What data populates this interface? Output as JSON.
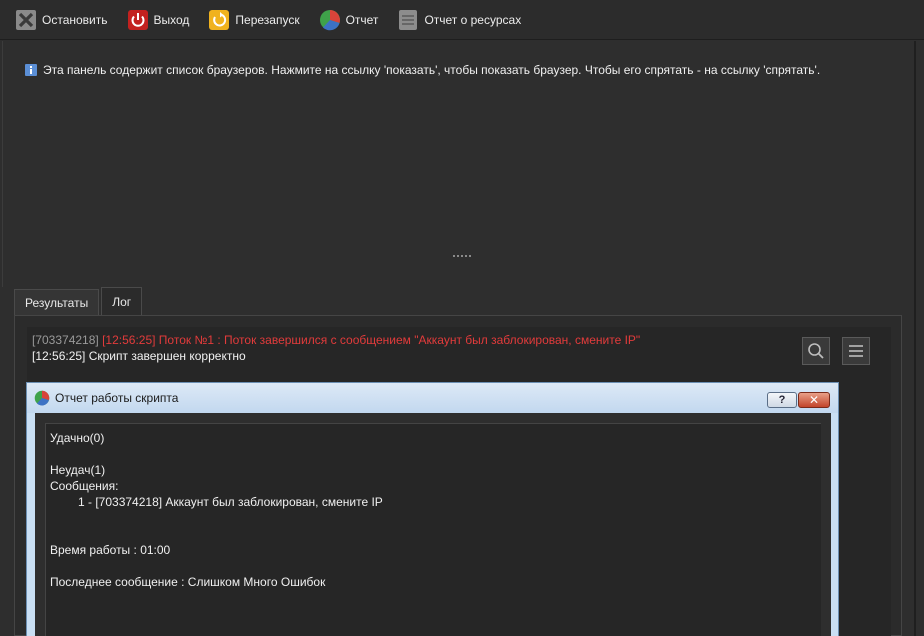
{
  "toolbar": {
    "stop_label": "Остановить",
    "exit_label": "Выход",
    "restart_label": "Перезапуск",
    "report_label": "Отчет",
    "resources_label": "Отчет о ресурсах"
  },
  "info": {
    "text": "Эта панель содержит список браузеров. Нажмите на ссылку 'показать', чтобы показать браузер. Чтобы его спрятать - на ссылку 'спрятать'."
  },
  "tabs": [
    {
      "label": "Результаты",
      "active": false
    },
    {
      "label": "Лог",
      "active": true
    }
  ],
  "log": {
    "line1_id": "[703374218]",
    "line1_message": "[12:56:25] Поток №1 : Поток завершился с сообщением \"Аккаунт был заблокирован, смените IP\"",
    "line2_message": "[12:56:25] Скрипт завершен корректно"
  },
  "dialog": {
    "title": "Отчет работы скрипта",
    "help_label": "?",
    "close_label": "✕",
    "report": {
      "success": "Удачно(0)",
      "failures": "Неудач(1)",
      "messages_header": "Сообщения:",
      "message_item": "1 - [703374218] Аккаунт был заблокирован, смените IP",
      "run_time": "Время работы : 01:00",
      "last_message": "Последнее сообщение : Слишком Много Ошибок"
    }
  },
  "colors": {
    "background": "#2e2e2e",
    "log_error": "#e23b3b",
    "dialog_frame": "#c9dff4"
  }
}
